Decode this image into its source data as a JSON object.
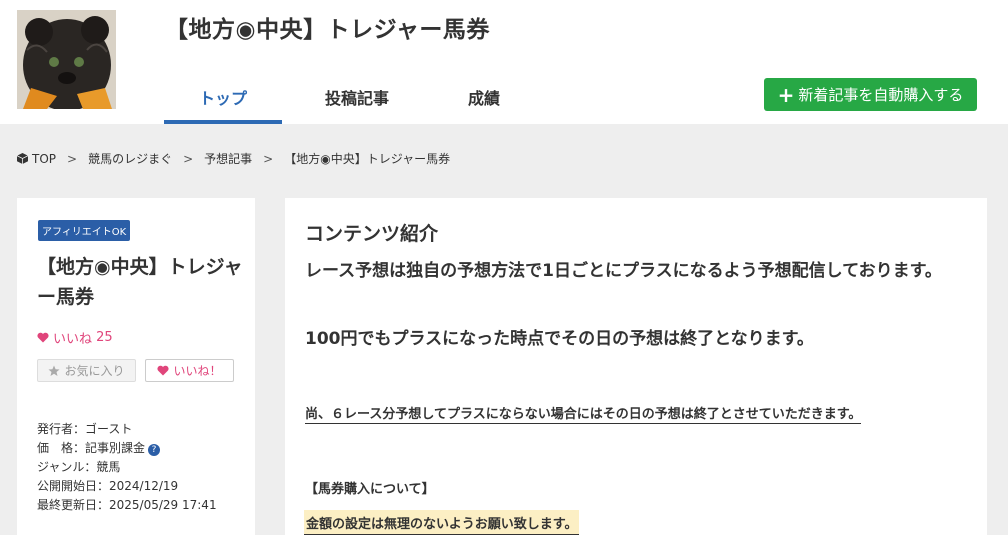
{
  "header": {
    "site_title": "【地方◉中央】トレジャー馬券",
    "tabs": [
      {
        "label": "トップ",
        "active": true
      },
      {
        "label": "投稿記事",
        "active": false
      },
      {
        "label": "成績",
        "active": false
      }
    ],
    "buy_button_label": "新着記事を自動購入する",
    "accent_color": "#2d6ab4",
    "buy_button_color": "#27a845"
  },
  "breadcrumb": [
    "TOP",
    "競馬のレジまぐ",
    "予想記事",
    "【地方◉中央】トレジャー馬券"
  ],
  "sidebar": {
    "badge": "アフィリエイトOK",
    "title": "【地方◉中央】トレジャー馬券",
    "likes_label": "いいね",
    "likes_count": "25",
    "favorite_button": "お気に入り",
    "like_button": "いいね！",
    "meta": {
      "publisher_label": "発行者：",
      "publisher": "ゴースト",
      "price_label": "価　格：",
      "price": "記事別課金",
      "genre_label": "ジャンル：",
      "genre": "競馬",
      "start_label": "公開開始日：",
      "start_date": "2024/12/19",
      "updated_label": "最終更新日：",
      "updated_date": "2025/05/29 17:41"
    }
  },
  "content": {
    "heading": "コンテンツ紹介",
    "paragraph1": "レース予想は独自の予想方法で1日ごとにプラスになるよう予想配信しております。",
    "paragraph2": "100円でもプラスになった時点でその日の予想は終了となります。",
    "note": "尚、６レース分予想してプラスにならない場合にはその日の予想は終了とさせていただきます。",
    "section_label": "【馬券購入について】",
    "highlight": "金額の設定は無理のないようお願い致します。"
  }
}
